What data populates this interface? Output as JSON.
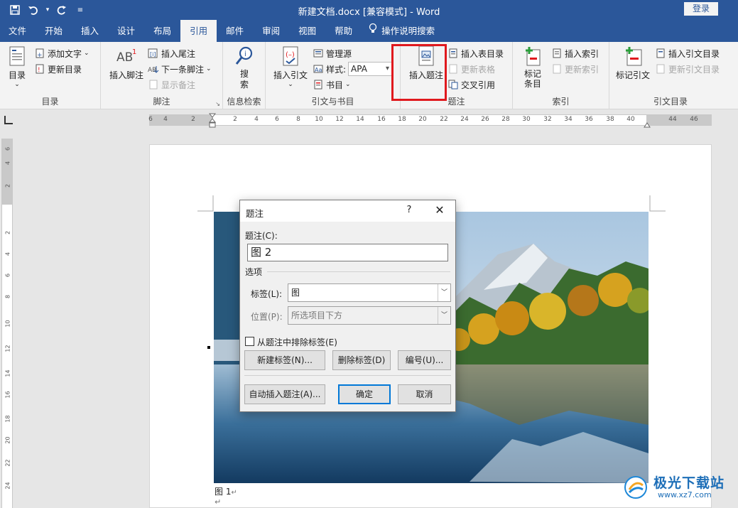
{
  "window": {
    "title": "新建文档.docx [兼容模式] - Word",
    "login_label": "登录"
  },
  "qat": {
    "icons": [
      "save-icon",
      "undo-icon",
      "redo-icon",
      "customize-icon"
    ]
  },
  "tabs": [
    "文件",
    "开始",
    "插入",
    "设计",
    "布局",
    "引用",
    "邮件",
    "审阅",
    "视图",
    "帮助"
  ],
  "active_tab": "引用",
  "tell_me": "操作说明搜索",
  "ribbon": {
    "toc": {
      "big_label": "目录",
      "add_text": "添加文字",
      "update_toc": "更新目录",
      "group": "目录"
    },
    "footnotes": {
      "insert_footnote": "插入脚注",
      "insert_endnote": "插入尾注",
      "next_footnote": "下一条脚注",
      "show_notes": "显示备注",
      "group": "脚注"
    },
    "research": {
      "search": "搜索",
      "group": "信息检索"
    },
    "citations": {
      "insert_citation": "插入引文",
      "manage_sources": "管理源",
      "style_label": "样式:",
      "style_value": "APA",
      "bibliography": "书目",
      "group": "引文与书目"
    },
    "captions": {
      "insert_caption": "插入题注",
      "insert_table_of_figures": "插入表目录",
      "update_table": "更新表格",
      "cross_reference": "交叉引用",
      "group": "题注"
    },
    "index": {
      "mark_entry": "标记\n条目",
      "insert_index": "插入索引",
      "update_index": "更新索引",
      "group": "索引"
    },
    "authorities": {
      "mark_citation": "标记引文",
      "insert_toa": "插入引文目录",
      "update_toa": "更新引文目录",
      "group": "引文目录"
    }
  },
  "ruler": {
    "h_labels": [
      "6",
      "4",
      "2",
      "2",
      "4",
      "6",
      "8",
      "10",
      "12",
      "14",
      "16",
      "18",
      "20",
      "22",
      "24",
      "26",
      "28",
      "30",
      "32",
      "34",
      "36",
      "38",
      "40",
      "44",
      "46"
    ],
    "v_labels": [
      "6",
      "4",
      "2",
      "2",
      "4",
      "6",
      "8",
      "10",
      "12",
      "14",
      "16",
      "18",
      "20",
      "22",
      "24"
    ]
  },
  "document": {
    "caption_text": "图 1",
    "para_mark": "↵"
  },
  "dialog": {
    "title": "题注",
    "help": "?",
    "caption_label": "题注(C):",
    "caption_value": "图 2",
    "options_label": "选项",
    "label_label": "标签(L):",
    "label_value": "图",
    "position_label": "位置(P):",
    "position_value": "所选项目下方",
    "exclude_label": "从题注中排除标签(E)",
    "new_label_btn": "新建标签(N)...",
    "delete_label_btn": "删除标签(D)",
    "numbering_btn": "编号(U)...",
    "autocaption_btn": "自动插入题注(A)...",
    "ok_btn": "确定",
    "cancel_btn": "取消"
  },
  "watermark": {
    "text": "极光下载站",
    "url": "www.xz7.com"
  },
  "colors": {
    "word_blue": "#2b579a",
    "highlight_red": "#e0191e",
    "default_button_border": "#0078d7"
  }
}
